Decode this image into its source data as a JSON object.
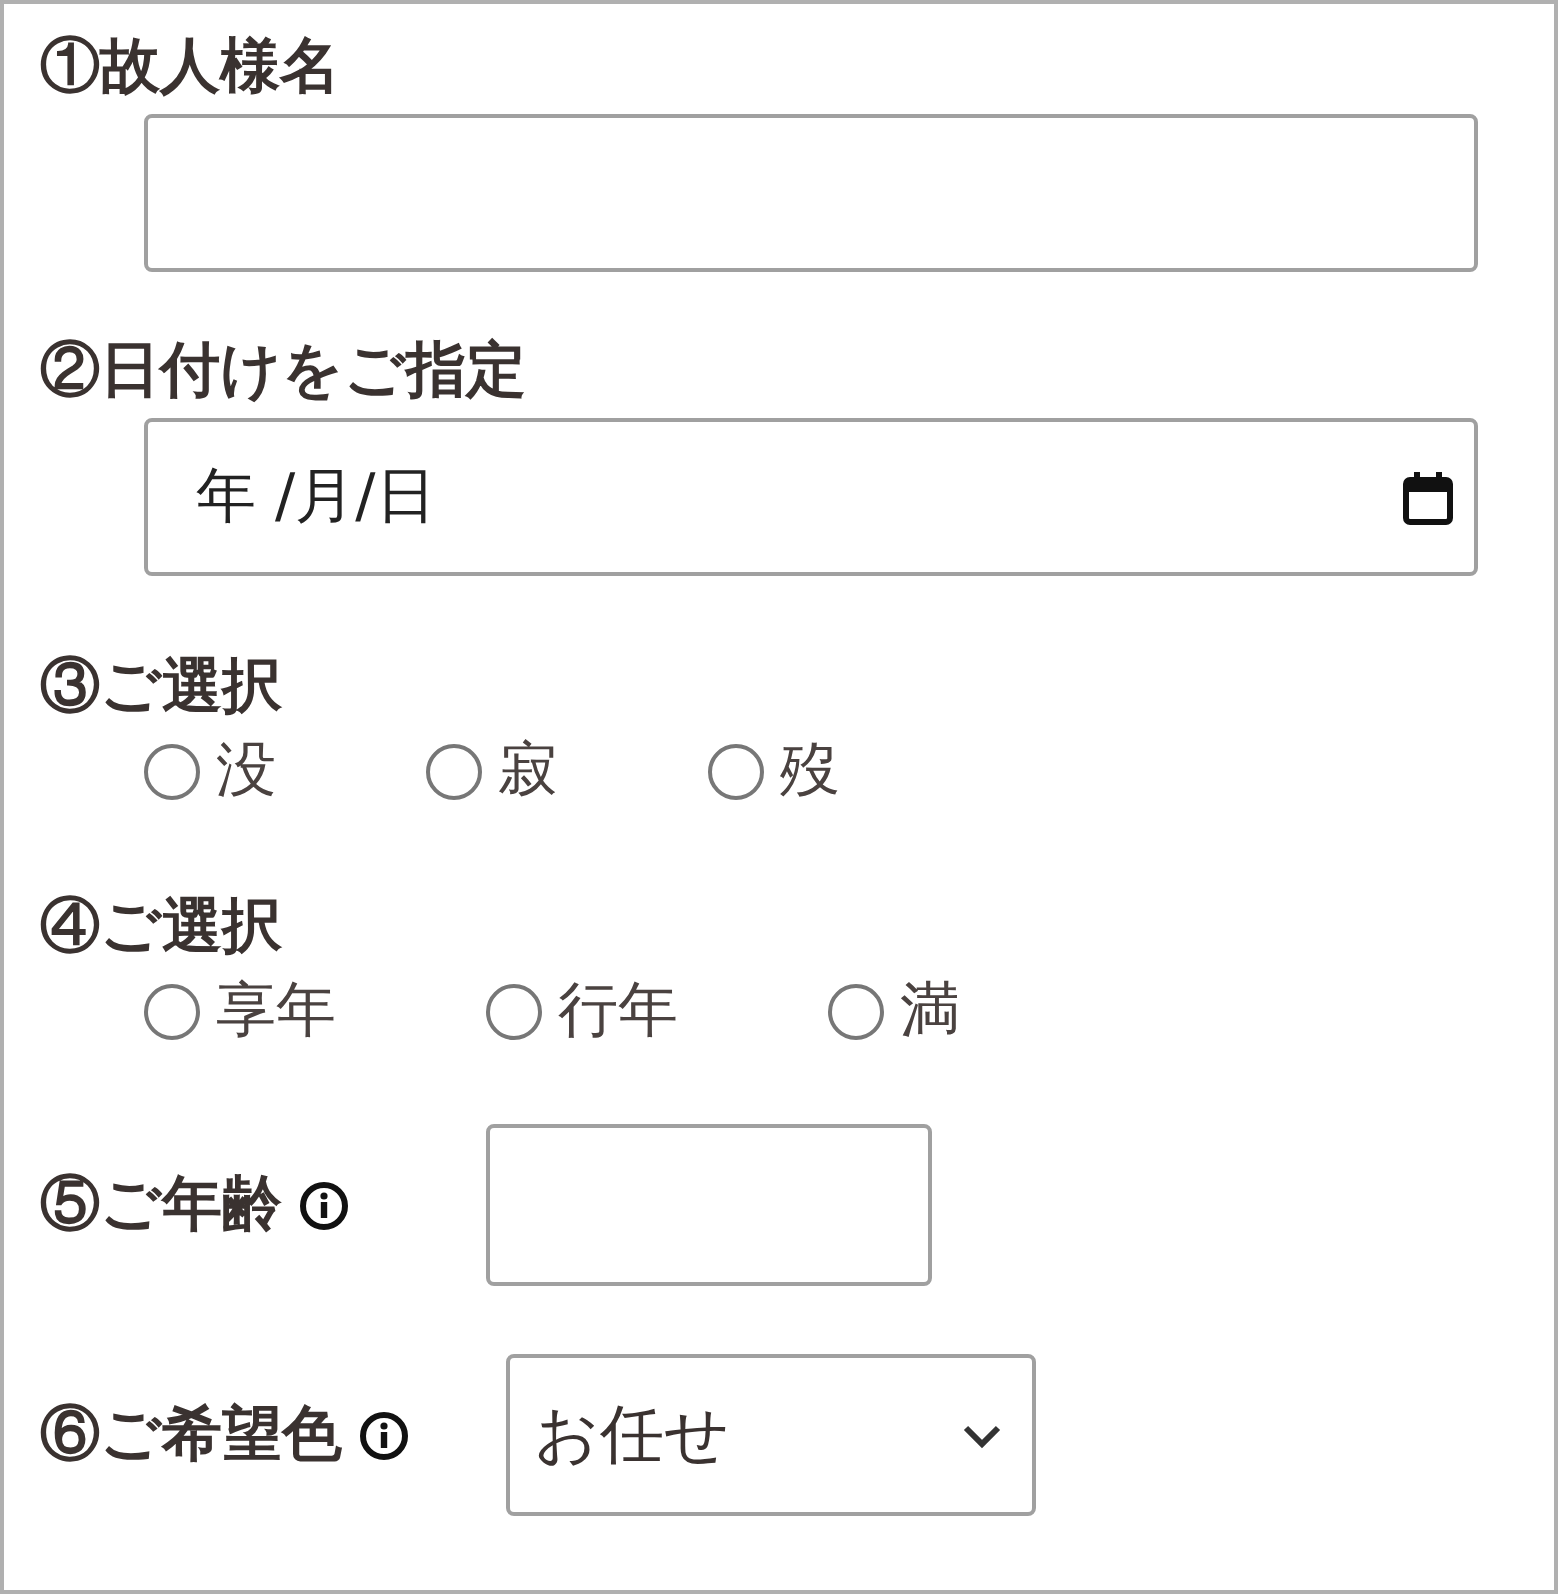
{
  "fields": [
    {
      "kind": "text",
      "label": "①故人様名"
    },
    {
      "kind": "date",
      "label": "②日付けをご指定",
      "placeholder": "年 /月/日"
    },
    {
      "kind": "radio",
      "label": "③ご選択",
      "options": [
        {
          "label": "没",
          "selected": false
        },
        {
          "label": "寂",
          "selected": false
        },
        {
          "label": "歿",
          "selected": false
        }
      ]
    },
    {
      "kind": "radio",
      "label": "④ご選択",
      "options": [
        {
          "label": "享年",
          "selected": false
        },
        {
          "label": "行年",
          "selected": false
        },
        {
          "label": "満",
          "selected": false
        }
      ]
    },
    {
      "kind": "inline-text",
      "label": "⑤ご年齢",
      "info": true
    },
    {
      "kind": "select",
      "label": "⑥ご希望色",
      "info": true,
      "value": "お任せ"
    }
  ]
}
